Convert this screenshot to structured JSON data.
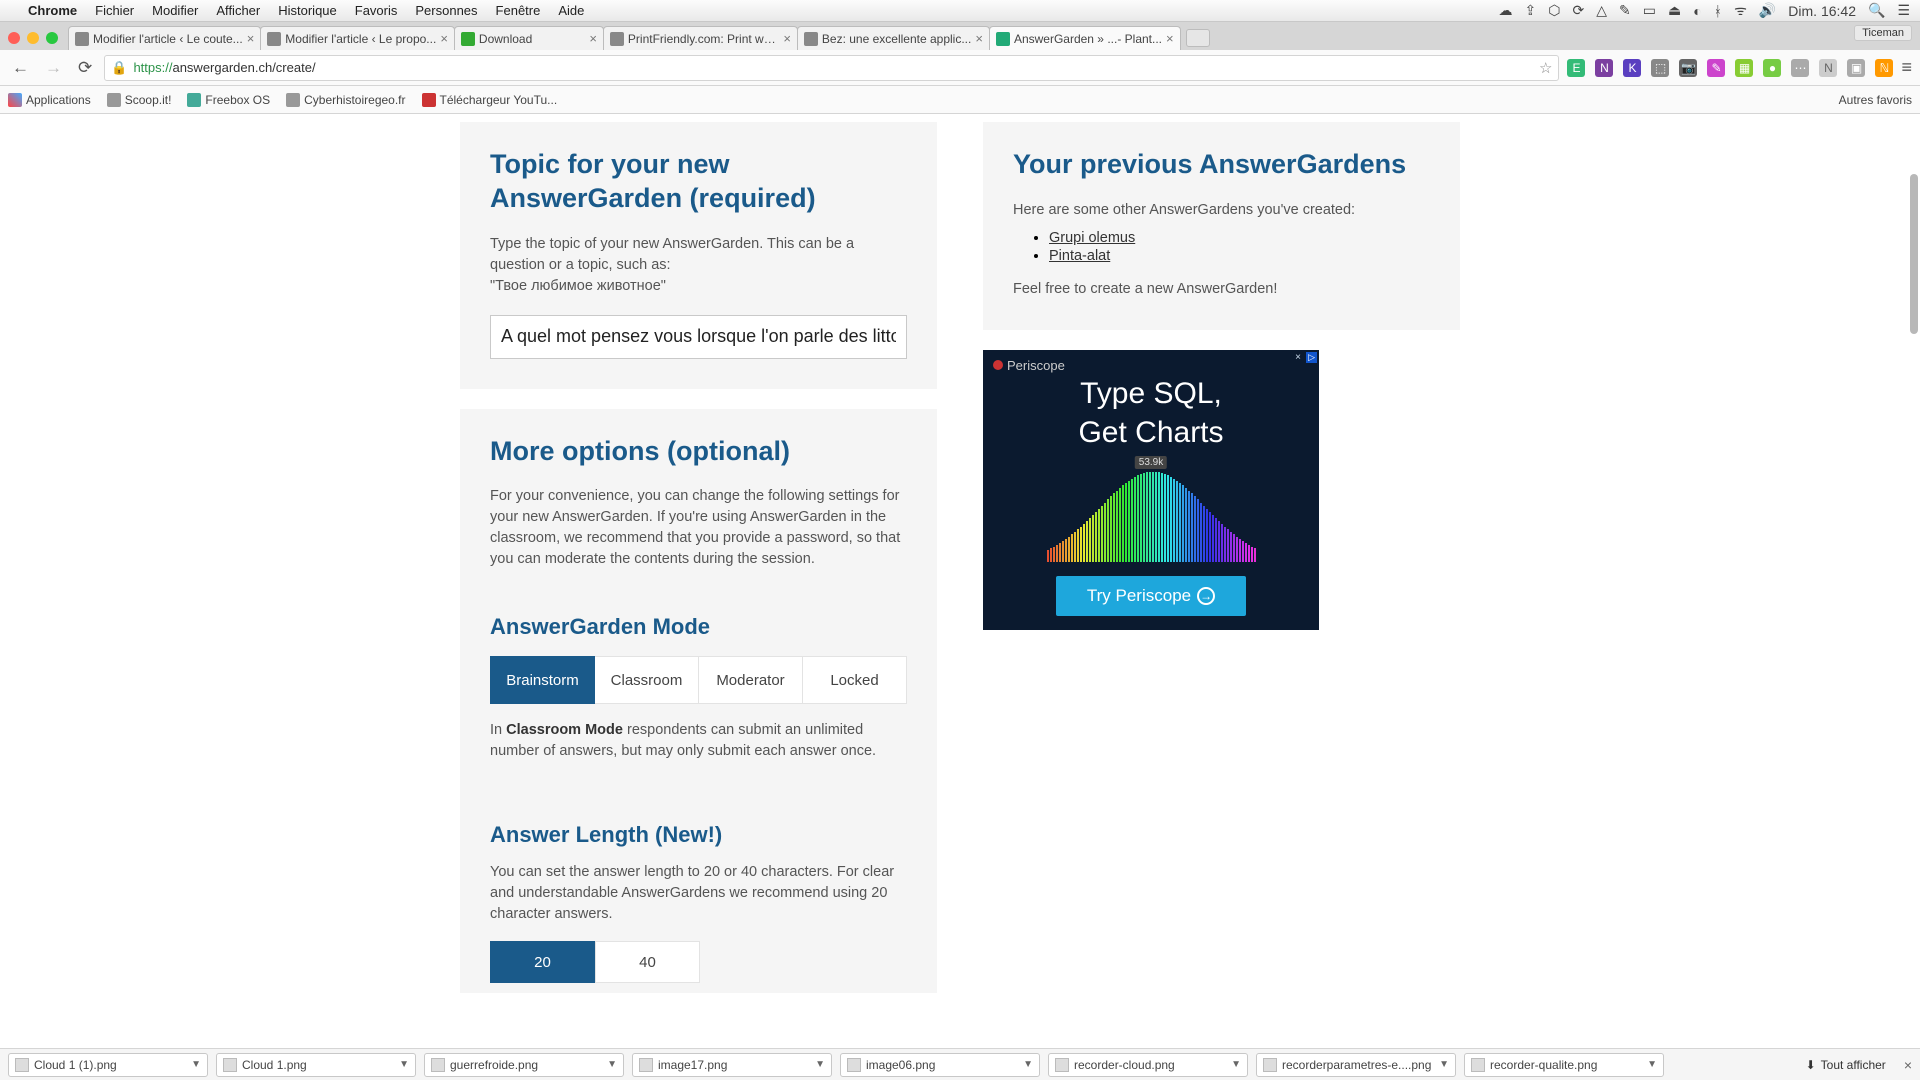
{
  "menubar": {
    "app": "Chrome",
    "items": [
      "Fichier",
      "Modifier",
      "Afficher",
      "Historique",
      "Favoris",
      "Personnes",
      "Fenêtre",
      "Aide"
    ],
    "clock": "Dim. 16:42"
  },
  "tabs": [
    {
      "title": "Modifier l'article ‹ Le coute..."
    },
    {
      "title": "Modifier l'article ‹ Le propo..."
    },
    {
      "title": "Download"
    },
    {
      "title": "PrintFriendly.com: Print we..."
    },
    {
      "title": "Bez: une excellente applic..."
    },
    {
      "title": "AnswerGarden » ...- Plant..."
    }
  ],
  "active_tab": 5,
  "user_badge": "Ticeman",
  "url": {
    "proto": "https://",
    "rest": "answergarden.ch/create/"
  },
  "bookmarks": {
    "items": [
      "Applications",
      "Scoop.it!",
      "Freebox OS",
      "Cyberhistoiregeo.fr",
      "Téléchargeur YouTu..."
    ],
    "other": "Autres favoris"
  },
  "main": {
    "topic": {
      "heading": "Topic for your new AnswerGarden (required)",
      "desc1": "Type the topic of your new AnswerGarden. This can be a question or a topic, such as:",
      "desc2": "\"Твое любимое животное\"",
      "value": "A quel mot pensez vous lorsque l'on parle des litto"
    },
    "options": {
      "heading": "More options (optional)",
      "desc": "For your convenience, you can change the following settings for your new AnswerGarden. If you're using AnswerGarden in the classroom, we recommend that you provide a password, so that you can moderate the contents during the session."
    },
    "mode": {
      "heading": "AnswerGarden Mode",
      "options": [
        "Brainstorm",
        "Classroom",
        "Moderator",
        "Locked"
      ],
      "active": 0,
      "desc_prefix": "In ",
      "desc_bold": "Classroom Mode",
      "desc_rest": " respondents can submit an unlimited number of answers, but may only submit each answer once."
    },
    "length": {
      "heading": "Answer Length (New!)",
      "desc": "You can set the answer length to 20 or 40 characters. For clear and understandable AnswerGardens we recommend using 20 character answers.",
      "options": [
        "20",
        "40"
      ],
      "active": 0
    }
  },
  "previous": {
    "heading": "Your previous AnswerGardens",
    "intro": "Here are some other AnswerGardens you've created:",
    "items": [
      "Grupi olemus",
      "Pinta-alat"
    ],
    "outro": "Feel free to create a new AnswerGarden!"
  },
  "ad": {
    "brand": "Periscope",
    "line1": "Type SQL,",
    "line2": "Get Charts",
    "badge": "53.9k",
    "cta": "Try Periscope"
  },
  "downloads": {
    "items": [
      "Cloud 1 (1).png",
      "Cloud 1.png",
      "guerrefroide.png",
      "image17.png",
      "image06.png",
      "recorder-cloud.png",
      "recorderparametres-e....png",
      "recorder-qualite.png"
    ],
    "showall": "Tout afficher"
  }
}
